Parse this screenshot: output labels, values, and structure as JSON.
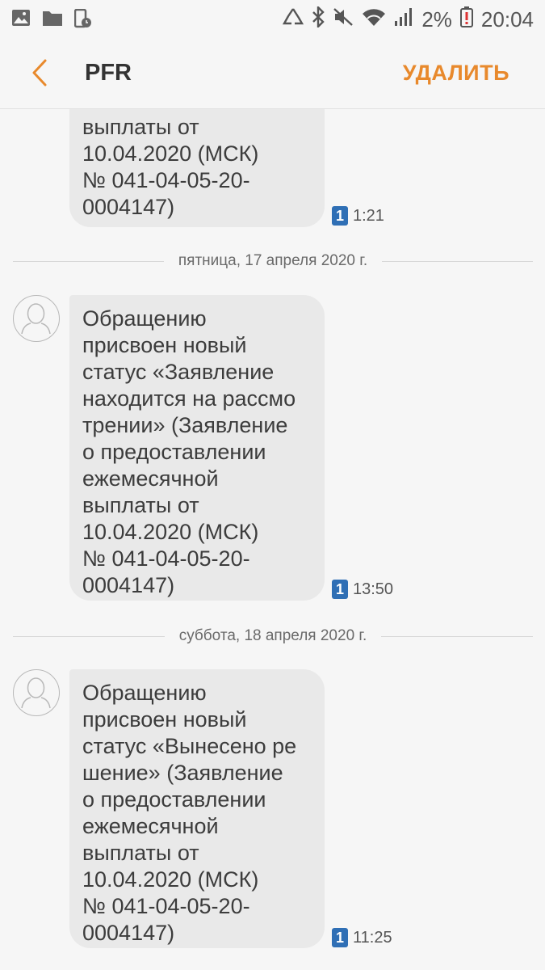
{
  "status_bar": {
    "battery_percent": "2%",
    "time": "20:04",
    "icons": [
      "gallery-icon",
      "folder-icon",
      "device-clock-icon",
      "recycle-icon",
      "bluetooth-icon",
      "mute-icon",
      "wifi-icon",
      "signal-icon",
      "battery-low-icon"
    ]
  },
  "header": {
    "title": "PFR",
    "delete_label": "УДАЛИТЬ",
    "accent_color": "#e8892c"
  },
  "messages": [
    {
      "lines": [
        "выплаты от",
        "10.04.2020 (МСК)",
        "№ 041-04-05-20-",
        "0004147)"
      ],
      "sim": "1",
      "time": "1:21"
    },
    {
      "date_separator": "пятница, 17 апреля 2020 г.",
      "lines": [
        "Обращению",
        "присвоен новый",
        "статус «Заявление",
        "находится на рассмо",
        "трении» (Заявление",
        "о предоставлении",
        "ежемесячной",
        "выплаты от",
        "10.04.2020 (МСК)",
        "№ 041-04-05-20-",
        "0004147)"
      ],
      "sim": "1",
      "time": "13:50"
    },
    {
      "date_separator": "суббота, 18 апреля 2020 г.",
      "lines": [
        "Обращению",
        "присвоен новый",
        "статус «Вынесено ре",
        "шение» (Заявление",
        "о предоставлении",
        "ежемесячной",
        "выплаты от",
        "10.04.2020 (МСК)",
        "№ 041-04-05-20-",
        "0004147)"
      ],
      "sim": "1",
      "time": "11:25"
    }
  ]
}
